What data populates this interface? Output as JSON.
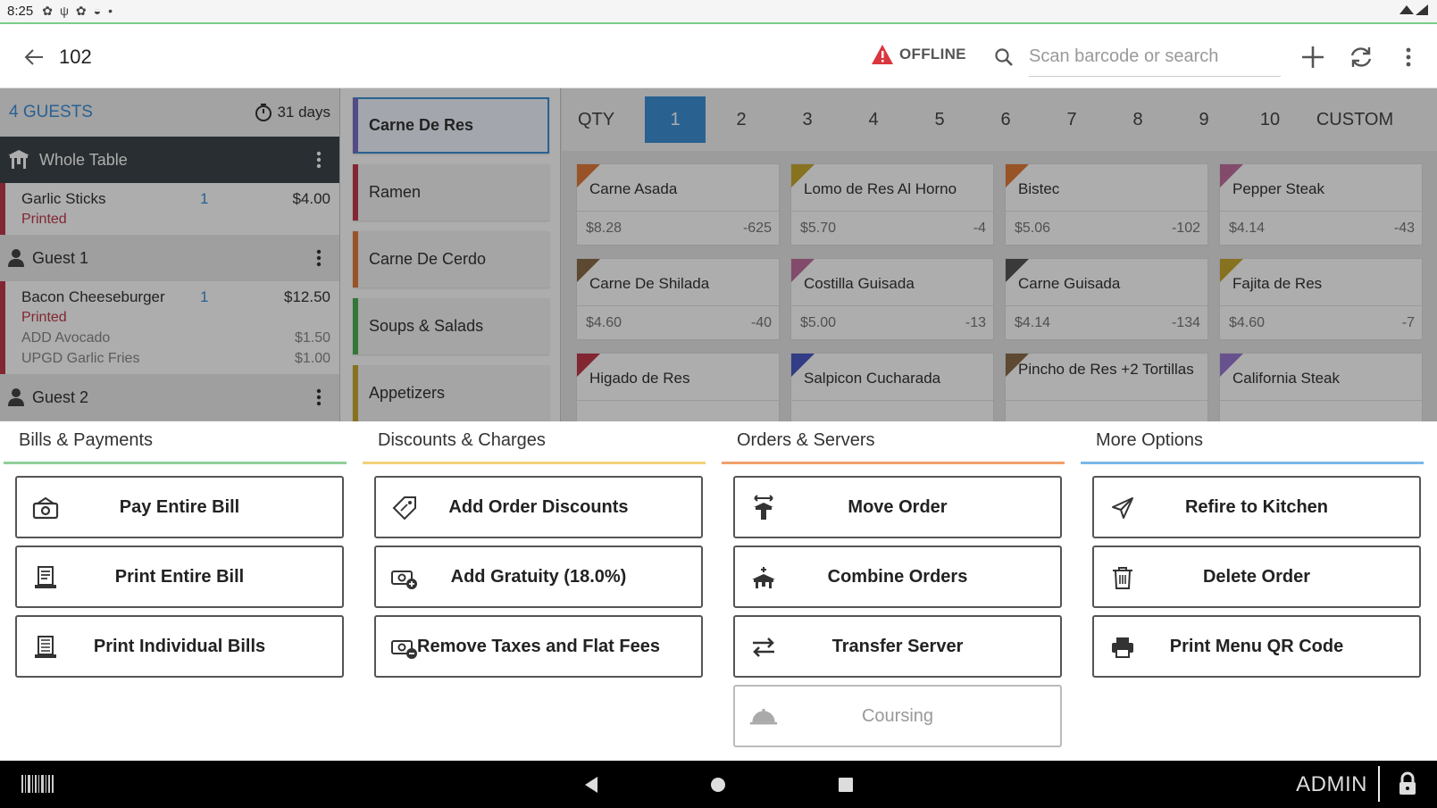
{
  "status_bar": {
    "time": "8:25"
  },
  "app_bar": {
    "title": "102",
    "offline_label": "OFFLINE",
    "search_placeholder": "Scan barcode or search",
    "accent_color": "#3d8fd6",
    "warning_color": "#d9363e"
  },
  "left_panel": {
    "guests_label": "4 GUESTS",
    "timer_label": "31 days",
    "whole_table_label": "Whole Table",
    "items": [
      {
        "name": "Garlic Sticks",
        "qty": "1",
        "price": "$4.00",
        "status": "Printed"
      },
      {
        "name": "Bacon Cheeseburger",
        "qty": "1",
        "price": "$12.50",
        "status": "Printed",
        "mods": [
          {
            "name": "ADD Avocado",
            "price": "$1.50"
          },
          {
            "name": "UPGD Garlic Fries",
            "price": "$1.00"
          }
        ]
      }
    ],
    "guest1_label": "Guest 1",
    "guest2_label": "Guest 2"
  },
  "categories": [
    {
      "label": "Carne De Res",
      "color": "#7a6fc4",
      "selected": true
    },
    {
      "label": "Ramen",
      "color": "#c0394a"
    },
    {
      "label": "Carne De Cerdo",
      "color": "#e07b3a"
    },
    {
      "label": "Soups & Salads",
      "color": "#4caf50"
    },
    {
      "label": "Appetizers",
      "color": "#c8a830"
    }
  ],
  "qty_bar": {
    "label": "QTY",
    "options": [
      "1",
      "2",
      "3",
      "4",
      "5",
      "6",
      "7",
      "8",
      "9",
      "10"
    ],
    "selected": "1",
    "custom_label": "CUSTOM"
  },
  "products": [
    {
      "name": "Carne Asada",
      "price": "$8.28",
      "stock": "-625",
      "color": "#e07b3a"
    },
    {
      "name": "Lomo de Res Al Horno",
      "price": "$5.70",
      "stock": "-4",
      "color": "#c8a830"
    },
    {
      "name": "Bistec",
      "price": "$5.06",
      "stock": "-102",
      "color": "#e07b3a"
    },
    {
      "name": "Pepper Steak",
      "price": "$4.14",
      "stock": "-43",
      "color": "#c06fa0"
    },
    {
      "name": "Carne De Shilada",
      "price": "$4.60",
      "stock": "-40",
      "color": "#8a6a4a"
    },
    {
      "name": "Costilla Guisada",
      "price": "$5.00",
      "stock": "-13",
      "color": "#c06fa0"
    },
    {
      "name": "Carne Guisada",
      "price": "$4.14",
      "stock": "-134",
      "color": "#555555"
    },
    {
      "name": "Fajita de Res",
      "price": "$4.60",
      "stock": "-7",
      "color": "#c8a830"
    },
    {
      "name": "Higado de Res",
      "price": "",
      "stock": "",
      "color": "#c0394a"
    },
    {
      "name": "Salpicon Cucharada",
      "price": "",
      "stock": "",
      "color": "#4a5ac4"
    },
    {
      "name": "Pincho de Res +2 Tortillas",
      "price": "",
      "stock": "",
      "color": "#8a6a4a"
    },
    {
      "name": "California Steak",
      "price": "",
      "stock": "",
      "color": "#9a7ad0"
    }
  ],
  "sheet": {
    "bills": {
      "header": "Bills & Payments",
      "color": "#8fcf9a",
      "buttons": [
        "Pay Entire Bill",
        "Print Entire Bill",
        "Print Individual Bills"
      ]
    },
    "discounts": {
      "header": "Discounts & Charges",
      "color": "#f0d27a",
      "buttons": [
        "Add Order Discounts",
        "Add Gratuity (18.0%)",
        "Remove Taxes and Flat Fees"
      ]
    },
    "orders": {
      "header": "Orders & Servers",
      "color": "#f0a06a",
      "buttons": [
        "Move Order",
        "Combine Orders",
        "Transfer Server",
        "Coursing"
      ]
    },
    "more": {
      "header": "More Options",
      "color": "#7ab8e8",
      "buttons": [
        "Refire to Kitchen",
        "Delete Order",
        "Print Menu QR Code"
      ]
    }
  },
  "nav_bar": {
    "user_label": "ADMIN"
  }
}
